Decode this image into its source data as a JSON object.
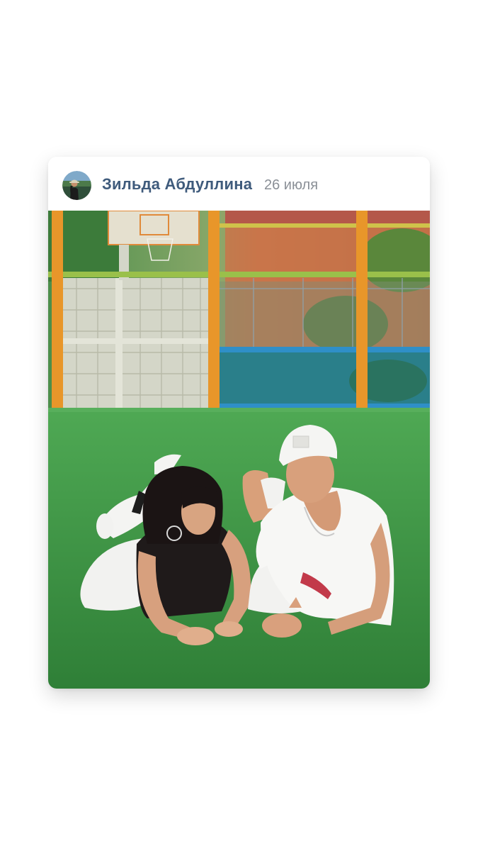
{
  "post": {
    "author": {
      "name": "Зильда Абдуллина",
      "avatar_icon": "profile-photo-avatar"
    },
    "date": "26 июля",
    "photo": {
      "icon": "post-photo-image"
    },
    "colors": {
      "author_name": "#3f5b7c",
      "date": "#8a8f96",
      "field_green": "#3f9a45",
      "fence_orange": "#e8962a"
    }
  }
}
